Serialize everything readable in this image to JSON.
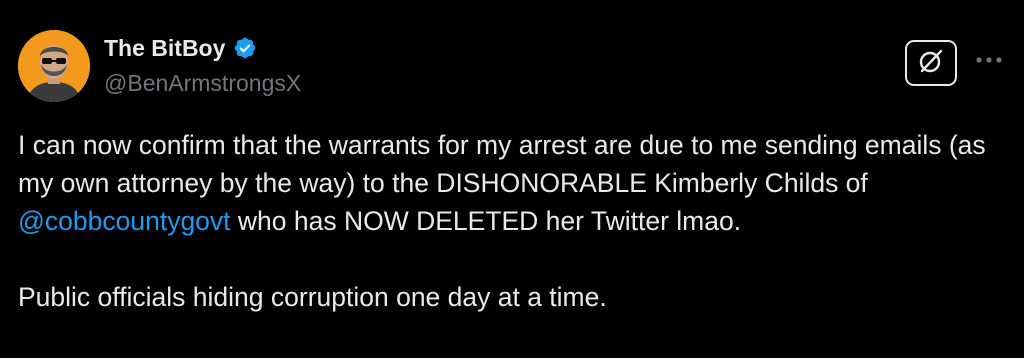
{
  "author": {
    "display_name": "The BitBoy",
    "handle": "@BenArmstrongsX",
    "verified_icon": "verified-badge-icon",
    "verified_color": "#1d9bf0"
  },
  "actions": {
    "grok_icon": "grok-icon",
    "more_icon": "more-dots-icon"
  },
  "tweet": {
    "line_part1": "I can now confirm that the warrants for my arrest are due to me sending emails (as my own attorney by the way) to the DISHONORABLE Kimberly Childs of ",
    "mention": "@cobbcountygovt",
    "line_part2": " who has NOW DELETED her Twitter lmao.",
    "paragraph2": "Public officials hiding corruption one day at a time."
  },
  "colors": {
    "background": "#000000",
    "text": "#e7e9ea",
    "secondary": "#71767b",
    "link": "#1d9bf0",
    "avatar_bg": "#f39a1c"
  }
}
